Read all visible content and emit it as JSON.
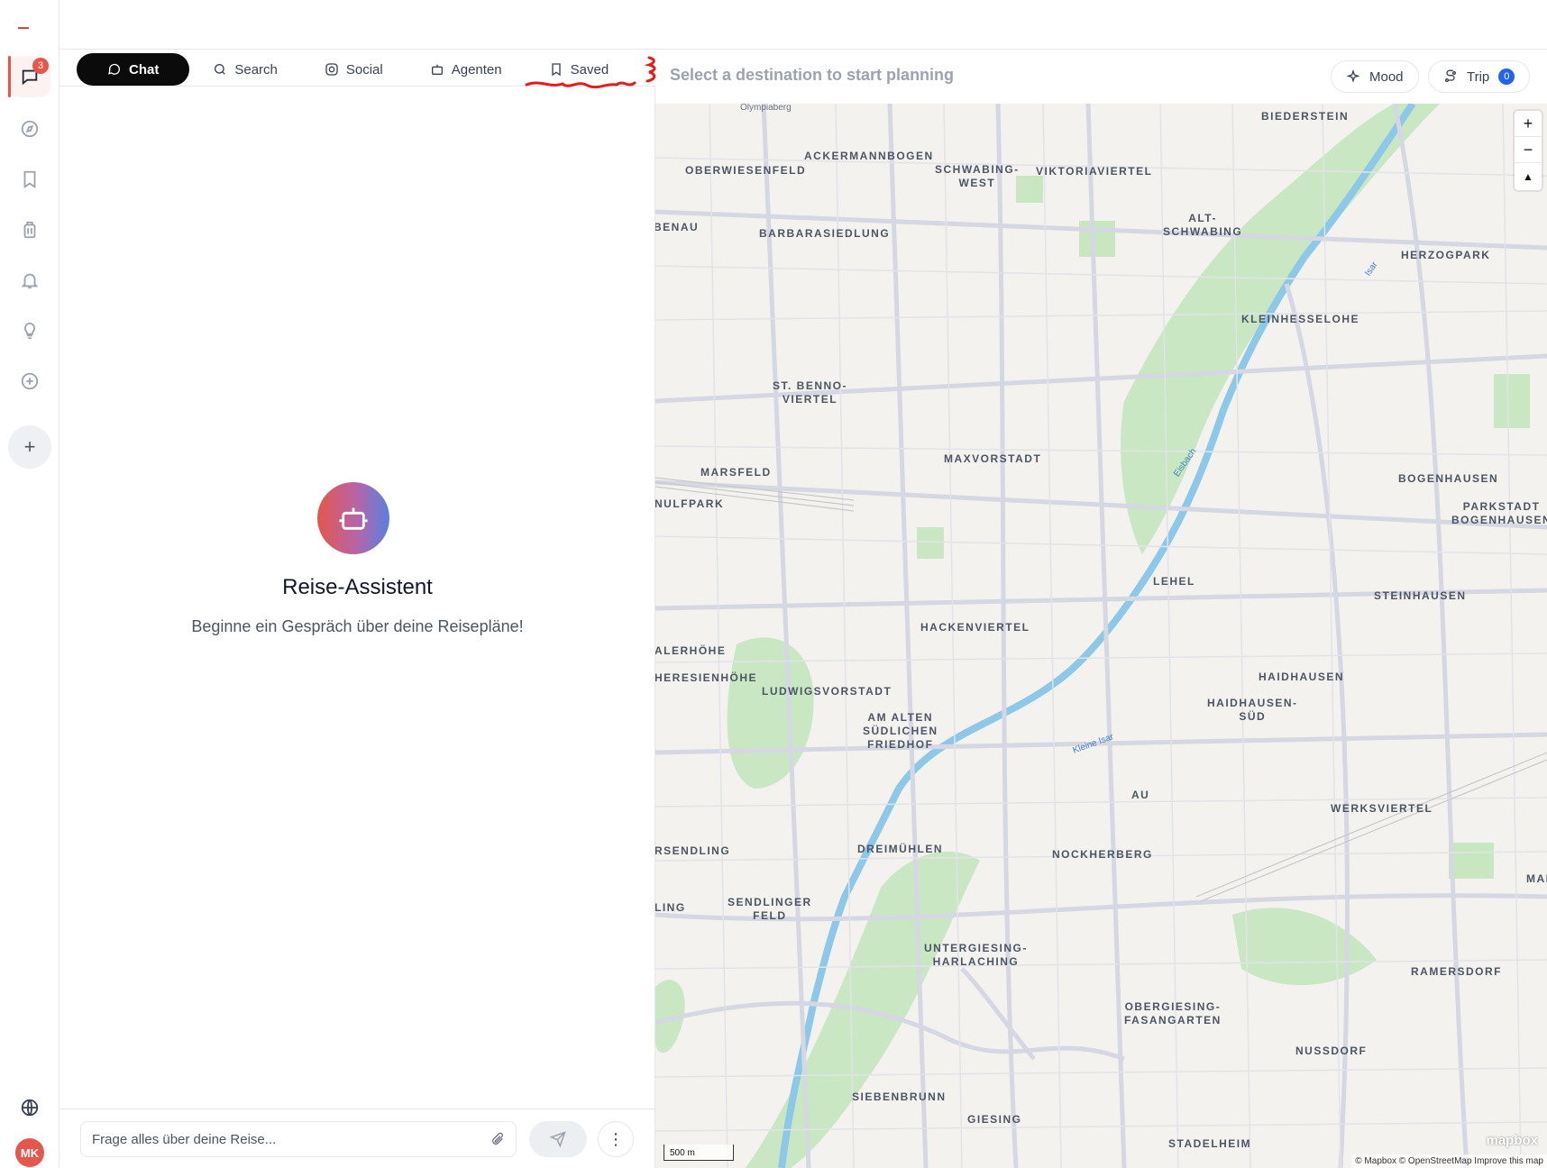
{
  "rail": {
    "chat_badge": "3",
    "avatar_initials": "MK",
    "items": [
      {
        "icon": "chat-icon",
        "active": true
      },
      {
        "icon": "compass-icon"
      },
      {
        "icon": "bookmark-icon"
      },
      {
        "icon": "luggage-icon"
      },
      {
        "icon": "bell-icon"
      },
      {
        "icon": "lightbulb-icon"
      },
      {
        "icon": "plus-circle-icon"
      }
    ],
    "add_label": "+",
    "globe_icon": "globe-icon"
  },
  "tabs": [
    {
      "label": "Chat",
      "icon": "chat-icon",
      "active": true
    },
    {
      "label": "Search",
      "icon": "search-icon"
    },
    {
      "label": "Social",
      "icon": "instagram-icon"
    },
    {
      "label": "Agenten",
      "icon": "robot-icon"
    },
    {
      "label": "Saved",
      "icon": "bookmark-icon"
    }
  ],
  "chat": {
    "assistant_title": "Reise-Assistent",
    "assistant_subtitle": "Beginne ein Gespräch über deine Reisepläne!",
    "input_placeholder": "Frage alles über deine Reise...",
    "more_label": "⋮"
  },
  "header": {
    "destination_hint": "Select a destination to start planning",
    "mood_label": "Mood",
    "trip_label": "Trip",
    "trip_count": "0"
  },
  "map": {
    "labels": [
      "Olympiaberg",
      "ACKERMANNBOGEN",
      "SCHWABING-\nWEST",
      "VIKTORIAVIERTEL",
      "BIEDERSTEIN",
      "OBERWIESENFELD",
      "BENAU",
      "BARBARASIEDLUNG",
      "ALT-\nSCHWABING",
      "HERZOGPARK",
      "KLEINHESSELOHE",
      "ST. BENNO-\nVIERTEL",
      "MAXVORSTADT",
      "MARSFELD",
      "NULFPARK",
      "BOGENHAUSEN",
      "PARKSTADT\nBOGENHAUSEN",
      "LEHEL",
      "STEINHAUSEN",
      "HACKENVIERTEL",
      "ALERHÖHE",
      "HERESIENHÖHE",
      "LUDWIGSVORSTADT",
      "HAIDHAUSEN",
      "HAIDHAUSEN-\nSÜD",
      "AM ALTEN\nSÜDLICHEN\nFRIEDHOF",
      "AU",
      "WERKSVIERTEL",
      "RSENDLING",
      "DREIMÜHLEN",
      "NOCKHERBERG",
      "MAI",
      "LING",
      "SENDLINGER\nFELD",
      "UNTERGIESING-\nHARLACHING",
      "RAMERSDORF",
      "OBERGIESING-\nFASANGARTEN",
      "NUSSDORF",
      "SIEBENBRUNN",
      "GIESING",
      "STADELHEIM"
    ],
    "river_labels": [
      "Isar",
      "Eisbach",
      "Kleine Isar"
    ],
    "zoom_in": "+",
    "zoom_out": "−",
    "compass": "▲",
    "scale": "500 m",
    "logo": "mapbox",
    "attribution": "© Mapbox © OpenStreetMap  Improve this map"
  },
  "colors": {
    "accent": "#e4574c",
    "active_tab": "#0b0b0b",
    "trip_badge": "#2563eb",
    "park": "#b8e0b0",
    "river": "#8ec8e8"
  }
}
